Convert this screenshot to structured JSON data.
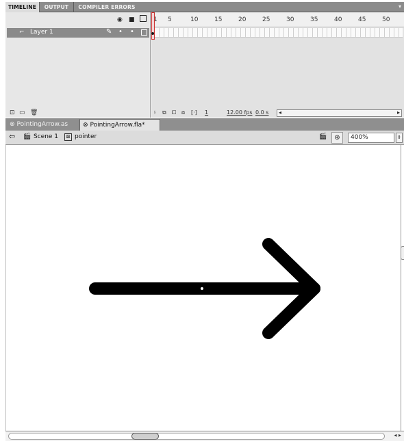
{
  "panel_tabs": [
    "TIMELINE",
    "OUTPUT",
    "COMPILER ERRORS"
  ],
  "timeline": {
    "layer_name": "Layer 1",
    "frame_numbers": [
      "1",
      "5",
      "10",
      "15",
      "20",
      "25",
      "30",
      "35",
      "40",
      "45",
      "50"
    ],
    "status": {
      "current_frame": "1",
      "fps": "12.00 fps",
      "time": "0.0 s"
    }
  },
  "doc_tabs": [
    {
      "label": "PointingArrow.as",
      "active": false
    },
    {
      "label": "PointingArrow.fla*",
      "active": true
    }
  ],
  "editbar": {
    "scene": "Scene 1",
    "symbol": "pointer",
    "zoom": "400%"
  },
  "stage": {
    "arrow_color": "#000000",
    "background": "#ffffff"
  },
  "icons": {
    "eye": "eye-icon",
    "lock": "lock-icon",
    "outline": "outline-icon",
    "back": "back-arrow-icon"
  }
}
